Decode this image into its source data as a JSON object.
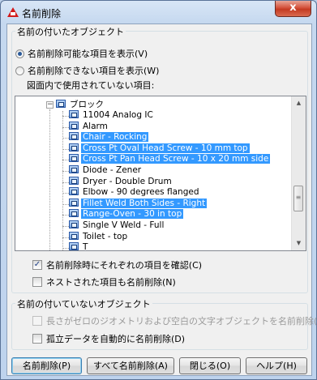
{
  "window": {
    "title": "名前削除",
    "close_glyph": "x"
  },
  "named_objects": {
    "group_label": "名前の付いたオブジェクト",
    "radio_purgeable": "名前削除可能な項目を表示(V)",
    "radio_nonpurgeable": "名前削除できない項目を表示(W)",
    "tree_caption": "図面内で使用されていない項目:",
    "tree": {
      "root": "ブロック",
      "items": [
        {
          "label": "11004 Analog IC",
          "selected": false
        },
        {
          "label": "Alarm",
          "selected": false
        },
        {
          "label": "Chair - Rocking",
          "selected": true
        },
        {
          "label": "Cross Pt Oval Head Screw - 10 mm top",
          "selected": true
        },
        {
          "label": "Cross Pt Pan Head Screw - 10 x 20 mm side",
          "selected": true
        },
        {
          "label": "Diode - Zener",
          "selected": false
        },
        {
          "label": "Dryer - Double Drum",
          "selected": false
        },
        {
          "label": "Elbow - 90 degrees flanged",
          "selected": false
        },
        {
          "label": "Fillet Weld Both Sides - Right",
          "selected": true
        },
        {
          "label": "Range-Oven - 30 in top",
          "selected": true
        },
        {
          "label": "Single V Weld - Full",
          "selected": false
        },
        {
          "label": "Toilet - top",
          "selected": false
        },
        {
          "label": "T                    ",
          "selected": false
        }
      ]
    },
    "check_confirm": "名前削除時にそれぞれの項目を確認(C)",
    "check_nested": "ネストされた項目も名前削除(N)",
    "confirm_checked": true,
    "nested_checked": false
  },
  "unnamed_objects": {
    "group_label": "名前の付いていないオブジェクト",
    "check_zero_geometry": "長さがゼロのジオメトリおよび空白の文字オブジェクトを名前削除(Z)",
    "check_orphan": "孤立データを自動的に名前削除(D)"
  },
  "buttons": {
    "purge": "名前削除(P)",
    "purge_all": "すべて名前削除(A)",
    "close": "閉じる(O)",
    "help": "ヘルプ(H)"
  },
  "icons": {
    "app": "autocad-logo-icon",
    "block": "block-icon",
    "close": "close-icon"
  }
}
